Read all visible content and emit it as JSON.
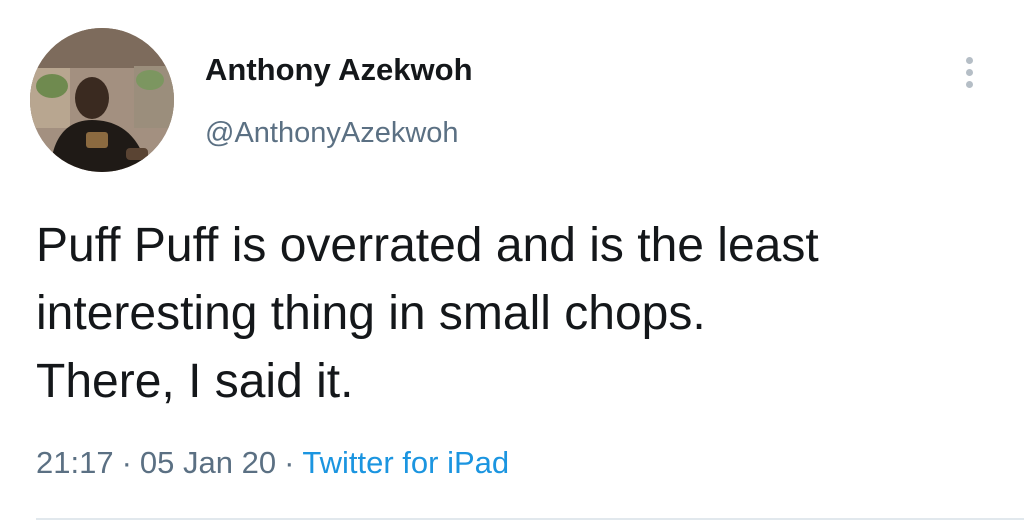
{
  "user": {
    "display_name": "Anthony Azekwoh",
    "handle": "@AnthonyAzekwoh",
    "avatar_icon": "profile-photo"
  },
  "tweet": {
    "lines": [
      "Puff Puff is overrated and is the least",
      "interesting thing in small chops.",
      "There, I said it."
    ],
    "time": "21:17",
    "date": "05 Jan 20",
    "separator": "·",
    "source": "Twitter for iPad"
  },
  "menu": {
    "icon": "more-vertical-icon"
  },
  "colors": {
    "text_primary": "#14171a",
    "text_secondary": "#5b7083",
    "link": "#1b95e0",
    "divider": "#e1e8ed"
  }
}
